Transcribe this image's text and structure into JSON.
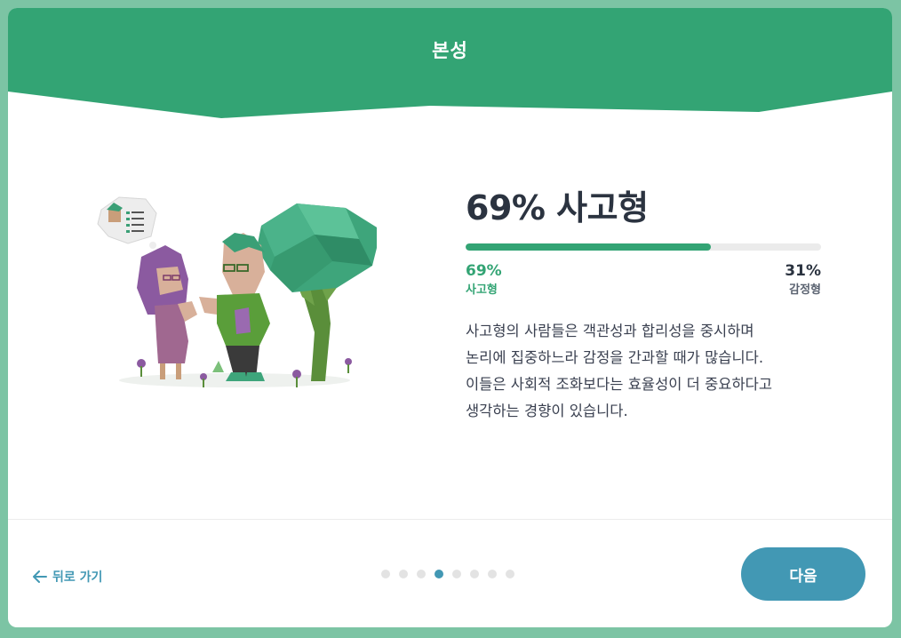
{
  "header": {
    "title": "본성"
  },
  "colors": {
    "accent_green": "#33a474",
    "accent_blue": "#4298b4",
    "background": "#7cc4a4"
  },
  "result": {
    "headline": "69% 사고형",
    "progress": 0.69,
    "left": {
      "percent": "69%",
      "trait": "사고형"
    },
    "right": {
      "percent": "31%",
      "trait": "감정형"
    },
    "description": [
      "사고형의 사람들은 객관성과 합리성을 중시하며",
      "논리에 집중하느라 감정을 간과할 때가 많습니다.",
      "이들은 사회적 조화보다는 효율성이 더 중요하다고",
      "생각하는 경향이 있습니다."
    ]
  },
  "illustration": {
    "name": "thinking-couple-illustration"
  },
  "footer": {
    "back_label": "뒤로 가기",
    "back_icon": "arrow-left-icon",
    "next_label": "다음",
    "pagination": {
      "total": 8,
      "current": 4
    }
  }
}
